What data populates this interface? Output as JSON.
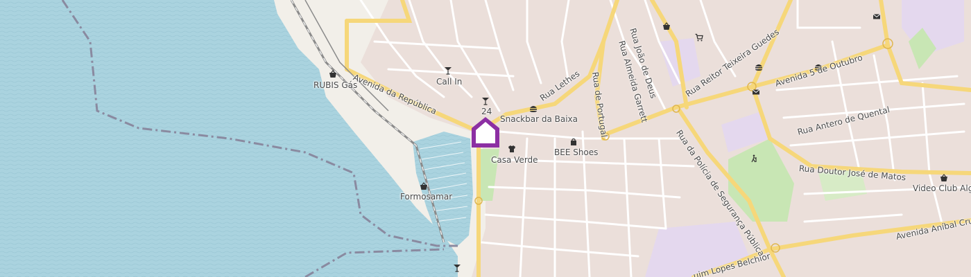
{
  "map": {
    "colors": {
      "water": "#aad3df",
      "land": "#f2efe9",
      "built": "#e8d9d4",
      "park": "#c8e6b4",
      "primary_road": "#f6d77a",
      "minor_road": "#ffffff",
      "marker": "#8c2fa3",
      "rail": "#8b8b8b",
      "boundary": "#8a8aa0",
      "purple_area": "#e4d8ee"
    },
    "marker": {
      "name": "selected-location",
      "icon": "house-pin"
    },
    "pois": [
      {
        "label": "RUBIS Gás",
        "icon": "shopping-basket-icon"
      },
      {
        "label": "Call In",
        "icon": "cocktail-icon"
      },
      {
        "label": "24",
        "icon": "cocktail-icon"
      },
      {
        "label": "Snackbar da Baixa",
        "icon": "hamburger-icon"
      },
      {
        "label": "Casa Verde",
        "icon": "tshirt-icon"
      },
      {
        "label": "BEE Shoes",
        "icon": "shopping-bag-icon"
      },
      {
        "label": "Formosamar",
        "icon": "shopping-basket-icon"
      },
      {
        "label": "Video Club Alga",
        "icon": "shopping-basket-icon"
      }
    ],
    "streets": [
      "Avenida da República",
      "Rua Lethes",
      "Rua de Portugal",
      "Rua Almeida Garrett",
      "Rua João de Deus",
      "Rua Reitor Teixeira Guedes",
      "Avenida 5 de Outubro",
      "Rua Antero de Quental",
      "Rua da Polícia de Segurança Pública",
      "Rua Doutor José de Matos",
      "Avenida Aníbal Cru",
      "uim Lopes Belchior"
    ],
    "unlabeled_icons": [
      "cocktail-icon",
      "hamburger-icon",
      "hamburger-icon",
      "shopping-basket-icon",
      "shopping-cart-icon",
      "mail-icon",
      "mail-icon",
      "hiking-icon"
    ]
  }
}
